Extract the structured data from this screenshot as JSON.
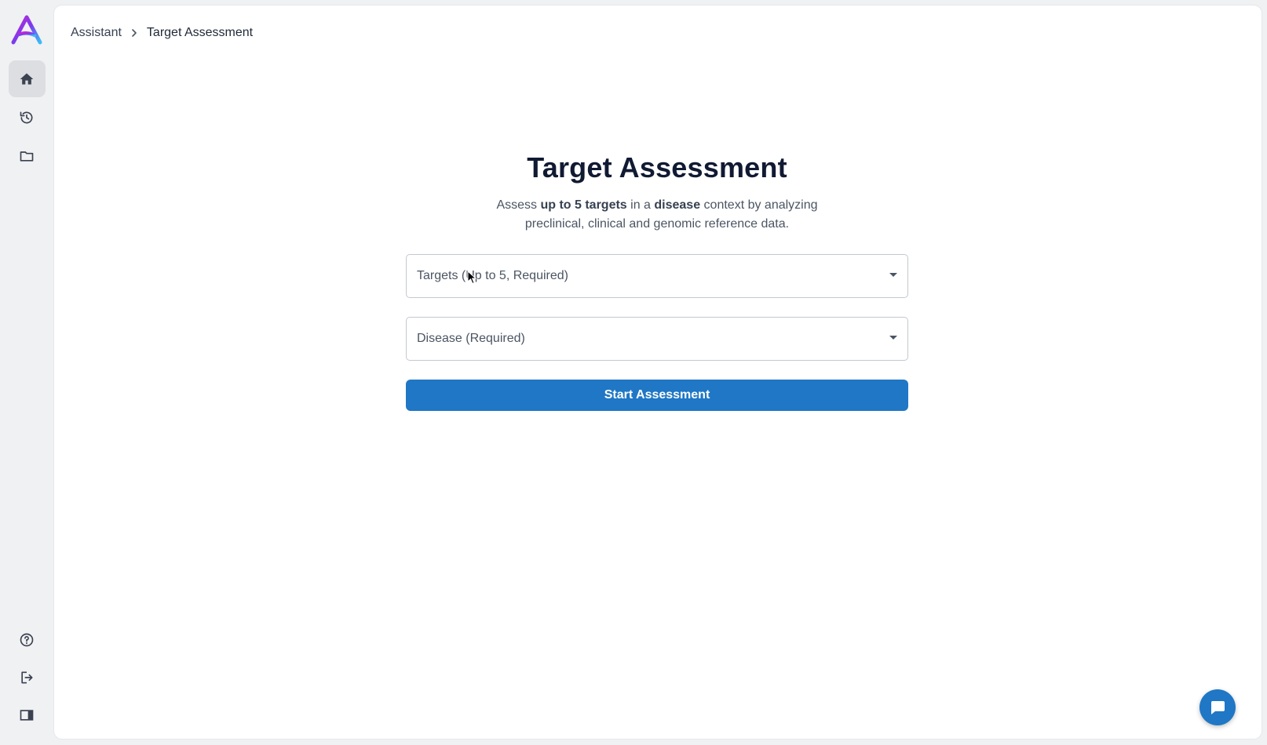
{
  "breadcrumb": {
    "parent": "Assistant",
    "current": "Target Assessment"
  },
  "main": {
    "title": "Target Assessment",
    "subtitle": {
      "part1": "Assess ",
      "bold1": "up to 5 targets",
      "part2": " in a ",
      "bold2": "disease",
      "part3": " context by analyzing preclinical, clinical and genomic reference data."
    },
    "targets_placeholder": "Targets (Up to 5, Required)",
    "disease_placeholder": "Disease (Required)",
    "start_label": "Start Assessment"
  },
  "sidebar": {
    "top_icons": [
      "home-icon",
      "history-icon",
      "folder-icon"
    ],
    "bottom_icons": [
      "help-icon",
      "logout-icon",
      "panel-toggle-icon"
    ]
  },
  "colors": {
    "accent": "#1f77c5",
    "sidebar_active": "#dcdee2",
    "title": "#111a33"
  }
}
